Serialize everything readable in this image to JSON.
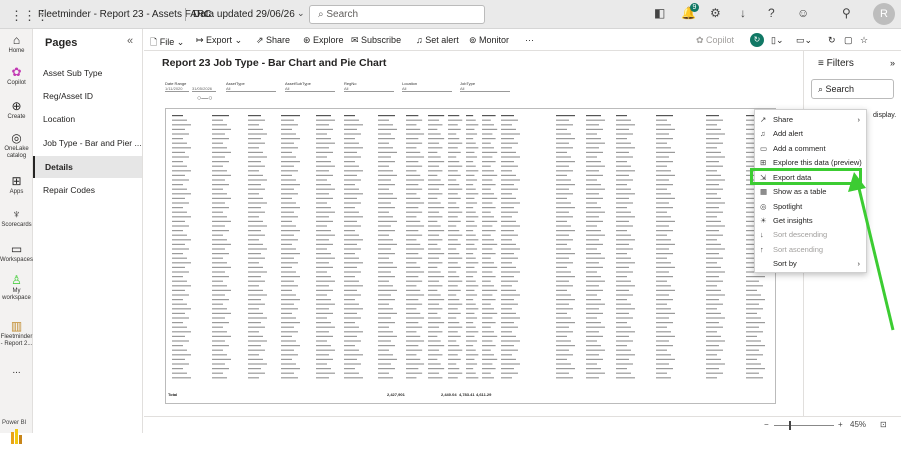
{
  "topbar": {
    "app_title": "Fleetminder - Report 23 - Assets FARC",
    "data_updated": "Data updated 29/06/26",
    "search_placeholder": "Search",
    "notification_count": "9",
    "avatar_initial": "R"
  },
  "rail": {
    "items": [
      {
        "label": "Home"
      },
      {
        "label": "Copilot"
      },
      {
        "label": "Create"
      },
      {
        "label": "OneLake catalog"
      },
      {
        "label": "Apps"
      },
      {
        "label": "Scorecards"
      },
      {
        "label": "Workspaces"
      },
      {
        "label": "My workspace"
      },
      {
        "label": "Fleetminder - Report 2..."
      },
      {
        "label": "..."
      }
    ],
    "pbi_label": "Power BI"
  },
  "pages": {
    "title": "Pages",
    "collapse_glyph": "«",
    "items": [
      {
        "label": "Asset Sub Type"
      },
      {
        "label": "Reg/Asset ID"
      },
      {
        "label": "Location"
      },
      {
        "label": "Job Type - Bar and Pier ..."
      },
      {
        "label": "Details"
      },
      {
        "label": "Repair Codes"
      }
    ]
  },
  "toolbar": {
    "file": "File",
    "export": "Export",
    "share": "Share",
    "explore": "Explore",
    "subscribe": "Subscribe",
    "set_alert": "Set alert",
    "monitor": "Monitor",
    "more": "···",
    "copilot": "Copilot"
  },
  "report": {
    "title": "Report 23 Job Type - Bar Chart and Pie Chart",
    "slicers": [
      {
        "label": "Date Range"
      },
      {
        "label": "AssetType"
      },
      {
        "label": "AssetSubType"
      },
      {
        "label": "RegNo"
      },
      {
        "label": "Location"
      },
      {
        "label": "JobType"
      }
    ],
    "slicer_values": [
      "All",
      "All",
      "All",
      "All",
      "All"
    ],
    "date_from": "1/11/2020",
    "date_to": "31/05/2026",
    "total_label": "Total",
    "total_values": [
      "2,427,901",
      "2,440.04",
      "4,783.41",
      "4,611.29"
    ]
  },
  "filters": {
    "title": "Filters",
    "search_placeholder": "Search",
    "display_text": "display."
  },
  "menu": {
    "items": [
      {
        "label": "Share",
        "icon": "share-icon",
        "glyph": "↗",
        "arrow": "›"
      },
      {
        "label": "Add alert",
        "icon": "bell-icon",
        "glyph": "🔔"
      },
      {
        "label": "Add a comment",
        "icon": "comment-icon",
        "glyph": "💬"
      },
      {
        "label": "Explore this data (preview)",
        "icon": "explore-icon",
        "glyph": "⊞"
      },
      {
        "label": "Export data",
        "icon": "export-icon",
        "glyph": "⇲"
      },
      {
        "label": "Show as a table",
        "icon": "table-icon",
        "glyph": "▦"
      },
      {
        "label": "Spotlight",
        "icon": "spotlight-icon",
        "glyph": "◎"
      },
      {
        "label": "Get insights",
        "icon": "insights-icon",
        "glyph": "💡"
      },
      {
        "label": "Sort descending",
        "icon": "sort-desc-icon",
        "glyph": "↓"
      },
      {
        "label": "Sort ascending",
        "icon": "sort-asc-icon",
        "glyph": "↑"
      },
      {
        "label": "Sort by",
        "icon": "",
        "glyph": "",
        "arrow": "›"
      }
    ]
  },
  "status": {
    "zoom_minus": "−",
    "zoom_plus": "+",
    "zoom_level": "45%"
  },
  "colors": {
    "highlight": "#3ccc32",
    "arrow": "#3ccc32",
    "teal": "#117865"
  }
}
